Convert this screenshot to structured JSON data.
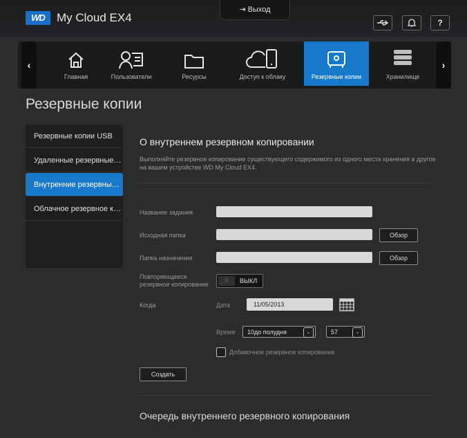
{
  "header": {
    "logo_text": "WD",
    "product_name": "My Cloud EX4",
    "logout_label": "Выход",
    "icons": [
      "usb-icon",
      "bell-icon",
      "help-icon"
    ],
    "help_label": "?"
  },
  "nav": {
    "items": [
      {
        "label": "Главная",
        "icon": "home-icon"
      },
      {
        "label": "Пользователи",
        "icon": "users-icon"
      },
      {
        "label": "Ресурсы",
        "icon": "folder-icon"
      },
      {
        "label": "Доступ к облаку",
        "icon": "cloud-icon"
      },
      {
        "label": "Резервные копии",
        "icon": "safe-icon",
        "active": true
      },
      {
        "label": "Хранилище",
        "icon": "storage-icon"
      }
    ],
    "prev": "‹",
    "next": "›"
  },
  "page": {
    "title": "Резервные копии"
  },
  "sidebar": {
    "items": [
      {
        "label": "Резервные копии USB"
      },
      {
        "label": "Удаленные резервные к..."
      },
      {
        "label": "Внутренние резервные ...",
        "active": true
      },
      {
        "label": "Облачное резервное ко..."
      }
    ]
  },
  "section": {
    "title": "О внутреннем резервном копировании",
    "description": "Выполняйте резервное копирование существующего содержимого из одного места хранения в другое на вашем устройстве WD My Cloud EX4."
  },
  "form": {
    "job_name_label": "Название задания",
    "source_label": "Исходная папка",
    "dest_label": "Папка назначения",
    "browse_label": "Обзор",
    "recurring_label": "Повторяющееся резервное копирование",
    "toggle_off_label": "ВЫКЛ",
    "toggle_knob": "|||",
    "when_label": "Когда",
    "date_label": "Дата",
    "date_value": "11/05/2013",
    "time_label": "Время",
    "hour_value": "10до полудня",
    "minute_value": "57",
    "incremental_label": "Добавочное резервное копирование",
    "create_label": "Создать"
  },
  "queue": {
    "title": "Очередь внутреннего резервного копирования"
  },
  "colors": {
    "accent": "#1779c9",
    "background": "#2b2c2e",
    "panel": "#1d1e20"
  }
}
